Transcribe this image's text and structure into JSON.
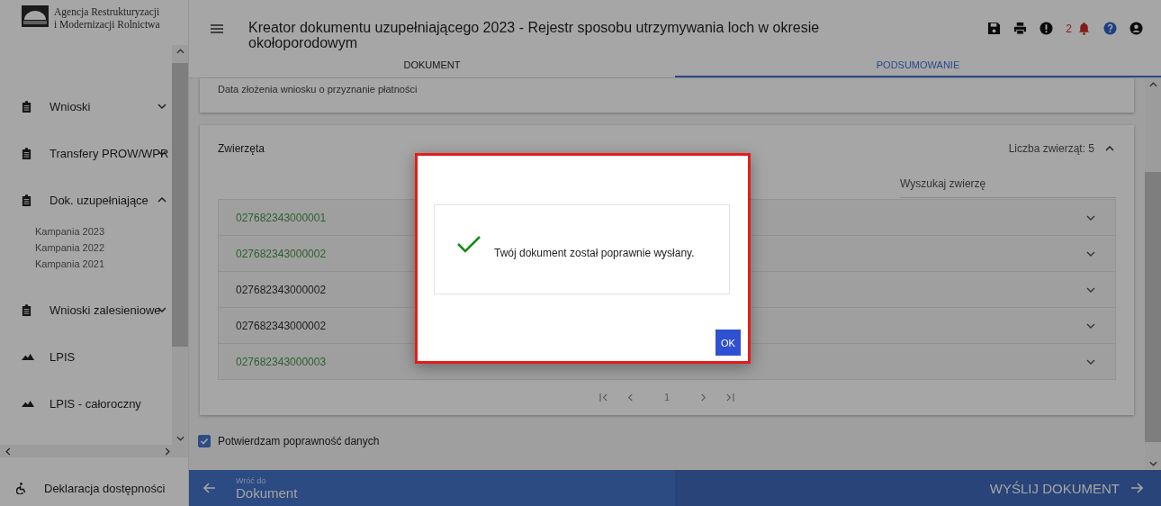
{
  "logo": {
    "line1": "Agencja Restrukturyzacji",
    "line2": "i Modernizacji Rolnictwa"
  },
  "sidebar": {
    "items": [
      {
        "kind": "group",
        "label": "Wnioski",
        "expanded": false
      },
      {
        "kind": "group",
        "label": "Transfery PROW/WPR",
        "expanded": false
      },
      {
        "kind": "group",
        "label": "Dok. uzupełniające",
        "expanded": true,
        "children": [
          {
            "label": "Kampania 2023"
          },
          {
            "label": "Kampania 2022"
          },
          {
            "label": "Kampania 2021"
          }
        ]
      },
      {
        "kind": "group",
        "label": "Wnioski zalesieniowe",
        "expanded": false
      },
      {
        "kind": "map",
        "label": "LPIS"
      },
      {
        "kind": "map",
        "label": "LPIS - całoroczny"
      }
    ],
    "footer_link": "Deklaracja dostępności"
  },
  "header": {
    "title": "Kreator dokumentu uzupełniającego 2023 - Rejestr sposobu utrzymywania loch w okresie okołoporodowym",
    "alert_count": "2"
  },
  "tabs": [
    {
      "label": "DOKUMENT",
      "selected": false
    },
    {
      "label": "PODSUMOWANIE",
      "selected": true
    }
  ],
  "date_row": {
    "label": "Data złożenia wniosku o przyznanie płatności"
  },
  "animals": {
    "title": "Zwierzęta",
    "count_label": "Liczba zwierząt: 5",
    "expanded": true,
    "search": {
      "placeholder": "Wyszukaj zwierzę"
    },
    "rows": [
      {
        "id": "027682343000001",
        "color": "#2f5e2f"
      },
      {
        "id": "027682343000002",
        "color": "#2f5e2f"
      },
      {
        "id": "027682343000002",
        "color": "#1c1c1c"
      },
      {
        "id": "027682343000002",
        "color": "#1c1c1c"
      },
      {
        "id": "027682343000003",
        "color": "#2f5e2f"
      }
    ],
    "page": "1"
  },
  "confirm": {
    "label": "Potwierdzam poprawność danych",
    "checked": true
  },
  "bottom_bar": {
    "back_caption": "Wróć do",
    "back_label": "Dokument",
    "send_label": "WYŚLIJ DOKUMENT"
  },
  "dialog": {
    "message": "Twój dokument został poprawnie wysłany.",
    "ok": "OK"
  }
}
